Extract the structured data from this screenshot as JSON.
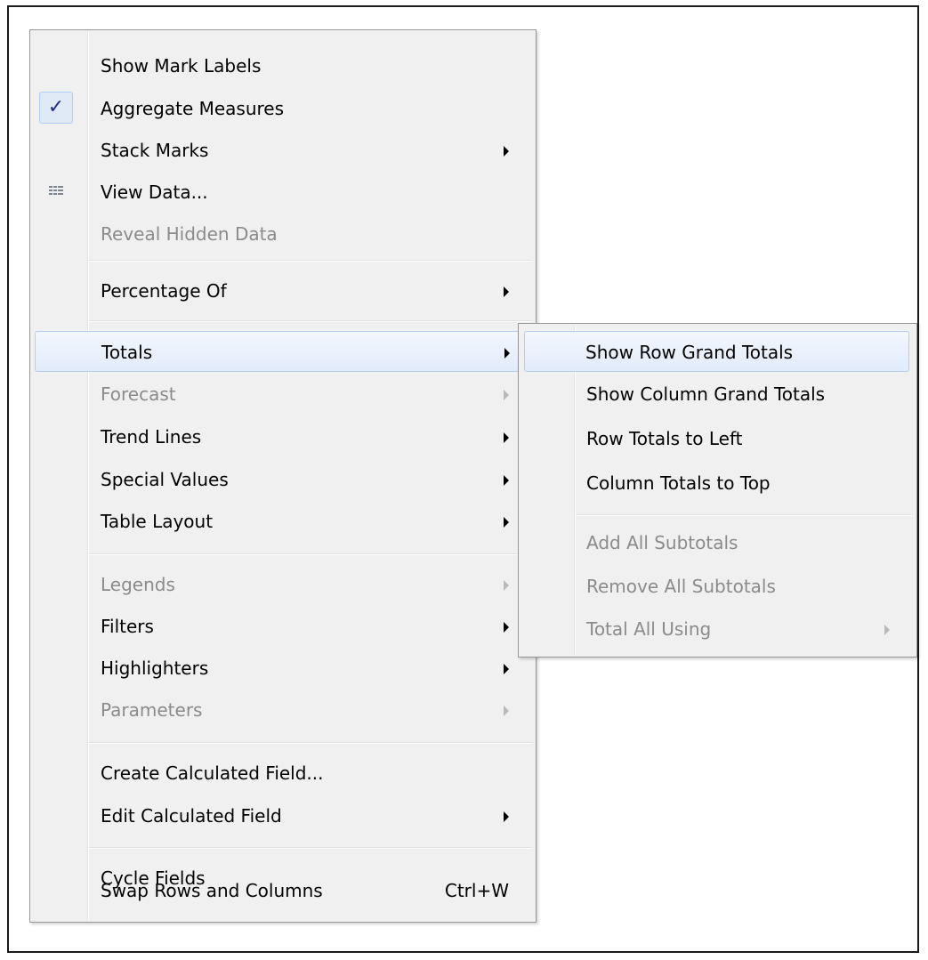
{
  "menu": {
    "items": [
      {
        "label": "Show Mark Labels",
        "enabled": true,
        "submenu": false
      },
      {
        "label": "Aggregate Measures",
        "enabled": true,
        "submenu": false,
        "checked": true
      },
      {
        "label": "Stack Marks",
        "enabled": true,
        "submenu": true
      },
      {
        "label": "View Data...",
        "enabled": true,
        "submenu": false,
        "icon": "grid-icon"
      },
      {
        "label": "Reveal Hidden Data",
        "enabled": false,
        "submenu": false
      },
      {
        "label": "Percentage Of",
        "enabled": true,
        "submenu": true
      },
      {
        "label": "Totals",
        "enabled": true,
        "submenu": true,
        "highlighted": true
      },
      {
        "label": "Forecast",
        "enabled": false,
        "submenu": true
      },
      {
        "label": "Trend Lines",
        "enabled": true,
        "submenu": true
      },
      {
        "label": "Special Values",
        "enabled": true,
        "submenu": true
      },
      {
        "label": "Table Layout",
        "enabled": true,
        "submenu": true
      },
      {
        "label": "Legends",
        "enabled": false,
        "submenu": true
      },
      {
        "label": "Filters",
        "enabled": true,
        "submenu": true
      },
      {
        "label": "Highlighters",
        "enabled": true,
        "submenu": true
      },
      {
        "label": "Parameters",
        "enabled": false,
        "submenu": true
      },
      {
        "label": "Create Calculated Field...",
        "enabled": true,
        "submenu": false
      },
      {
        "label": "Edit Calculated Field",
        "enabled": true,
        "submenu": true
      },
      {
        "label": "Cycle Fields",
        "enabled": true,
        "submenu": false
      },
      {
        "label": "Swap Rows and Columns",
        "enabled": true,
        "submenu": false,
        "shortcut": "Ctrl+W"
      }
    ],
    "check_glyph": "✓"
  },
  "totals_submenu": {
    "items": [
      {
        "label": "Show Row Grand Totals",
        "enabled": true,
        "submenu": false,
        "highlighted": true
      },
      {
        "label": "Show Column Grand Totals",
        "enabled": true,
        "submenu": false
      },
      {
        "label": "Row Totals to Left",
        "enabled": true,
        "submenu": false
      },
      {
        "label": "Column Totals to Top",
        "enabled": true,
        "submenu": false
      },
      {
        "label": "Add All Subtotals",
        "enabled": false,
        "submenu": false
      },
      {
        "label": "Remove All Subtotals",
        "enabled": false,
        "submenu": false
      },
      {
        "label": "Total All Using",
        "enabled": false,
        "submenu": true
      }
    ]
  },
  "colors": {
    "menu_bg": "#f0f0f0",
    "disabled_text": "#8b8b8b",
    "highlight": "#dce7f8",
    "check": "#1c2a8c"
  }
}
